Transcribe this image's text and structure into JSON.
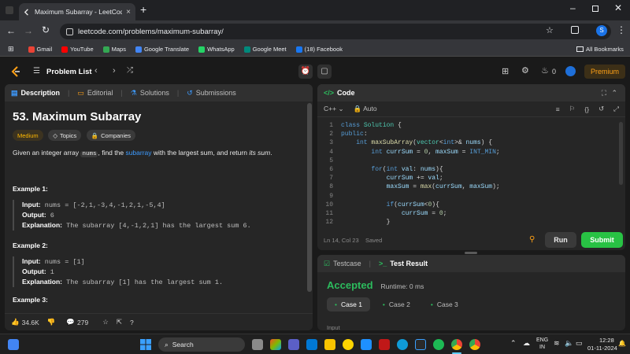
{
  "browser": {
    "tab_title": "Maximum Subarray - LeetCode",
    "url": "leetcode.com/problems/maximum-subarray/",
    "profile_initial": "S",
    "bookmarks": [
      {
        "label": "Gmail",
        "color": "#ea4335"
      },
      {
        "label": "YouTube",
        "color": "#ff0000"
      },
      {
        "label": "Maps",
        "color": "#34a853"
      },
      {
        "label": "Google Translate",
        "color": "#4285f4"
      },
      {
        "label": "WhatsApp",
        "color": "#25d366"
      },
      {
        "label": "Google Meet",
        "color": "#00897b"
      },
      {
        "label": "(18) Facebook",
        "color": "#1877f2"
      }
    ],
    "all_bookmarks": "All Bookmarks"
  },
  "nav": {
    "problem_list": "Problem List",
    "streak": "0",
    "premium": "Premium"
  },
  "description": {
    "tabs": [
      "Description",
      "Editorial",
      "Solutions",
      "Submissions"
    ],
    "title": "53. Maximum Subarray",
    "difficulty": "Medium",
    "topics": "Topics",
    "companies": "Companies",
    "statement_pre": "Given an integer array ",
    "statement_code": "nums",
    "statement_mid": ", find the ",
    "statement_link": "subarray",
    "statement_post": " with the largest sum, and return ",
    "statement_em": "its sum",
    "statement_end": ".",
    "examples": [
      {
        "head": "Example 1:",
        "input_label": "Input:",
        "input": "nums = [-2,1,-3,4,-1,2,1,-5,4]",
        "output_label": "Output:",
        "output": "6",
        "expl_label": "Explanation:",
        "expl": "The subarray [4,-1,2,1] has the largest sum 6."
      },
      {
        "head": "Example 2:",
        "input_label": "Input:",
        "input": "nums = [1]",
        "output_label": "Output:",
        "output": "1",
        "expl_label": "Explanation:",
        "expl": "The subarray [1] has the largest sum 1."
      }
    ],
    "example3_head": "Example 3:",
    "likes": "34.6K",
    "comments": "279"
  },
  "code": {
    "title": "Code",
    "language": "C++",
    "mode": "Auto",
    "lines": [
      "class Solution {",
      "public:",
      "    int maxSubArray(vector<int>& nums) {",
      "        int currSum = 0, maxSum = INT_MIN;",
      "",
      "        for(int val: nums){",
      "            currSum += val;",
      "            maxSum = max(currSum, maxSum);",
      "",
      "            if(currSum<0){",
      "                currSum = 0;",
      "            }"
    ],
    "status": "Ln 14, Col 23",
    "saved": "Saved",
    "run": "Run",
    "submit": "Submit"
  },
  "result": {
    "tab_testcase": "Testcase",
    "tab_result": "Test Result",
    "verdict": "Accepted",
    "runtime": "Runtime: 0 ms",
    "cases": [
      "Case 1",
      "Case 2",
      "Case 3"
    ],
    "input_label": "Input"
  },
  "taskbar": {
    "search": "Search",
    "lang1": "ENG",
    "lang2": "IN",
    "time": "12:28",
    "date": "01-11-2024"
  },
  "colors": {
    "accent_orange": "#ffa116",
    "accepted_green": "#2cbb5d",
    "submit_green": "#28c244",
    "link_blue": "#3d9bff"
  }
}
